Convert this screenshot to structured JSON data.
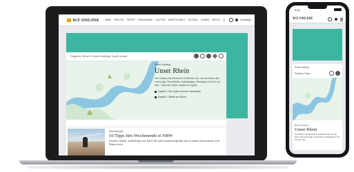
{
  "colors": {
    "accent_teal": "#3cb5a1",
    "logo_gold": "#e0a200",
    "river_blue": "#8cc6e0",
    "map_green": "#cfe8d0"
  },
  "desktop": {
    "logo": "WZ ONLINE",
    "nav_items": [
      "NRW",
      "POLITIK",
      "SPORT",
      "PANORAMA",
      "KULTUR",
      "WIRTSCHAFT",
      "DIGITAL",
      "LEBEN",
      "REGIO",
      "Q"
    ],
    "login_label": "Anmelden",
    "toolbar": {
      "left_text": "Ratgeber  Reise  Freizeit  Ausflüge  Spaß  Urlaub",
      "icons": [
        "location-icon",
        "settings-icon",
        "bookmark-icon",
        "add-icon",
        "share-icon"
      ]
    },
    "article": {
      "kicker": "Rhein-Radweg",
      "headline": "Unser Rhein",
      "lead": "Von Koblenz bis Emmerich: Entdecken Sie, wie der Strom das Land prägt. Geschichten, Ausflugstipps, Radwege und Orte am Ufer – Stück für Stück, Kapitel für Kapitel.",
      "bullets": [
        "Kapitel 1: Die Quelle und ihre Geschichte",
        "Kapitel 2: Städte am Strom"
      ]
    },
    "teaser": {
      "kicker": "Wochenende",
      "title": "10 Tipps fürs Wochenende in NRW",
      "lead": "Konzerte, Märkte, Ausstellungen und Sport: Wir haben zusammengestellt, was an diesem Wochenende in der Region los ist."
    }
  },
  "phone": {
    "time": "9:41",
    "logo": "WZ ONLINE",
    "toolbar_label": "Rhein-Radweg",
    "toolbar_sub": "Ratgeber  Reise",
    "kicker": "Rhein-Radweg",
    "headline": "Unser Rhein",
    "lead": "Von Koblenz bis Emmerich: Entdecken Sie, wie der Strom das Land prägt. Geschichten, Ausflugstipps und Orte am Ufer."
  }
}
